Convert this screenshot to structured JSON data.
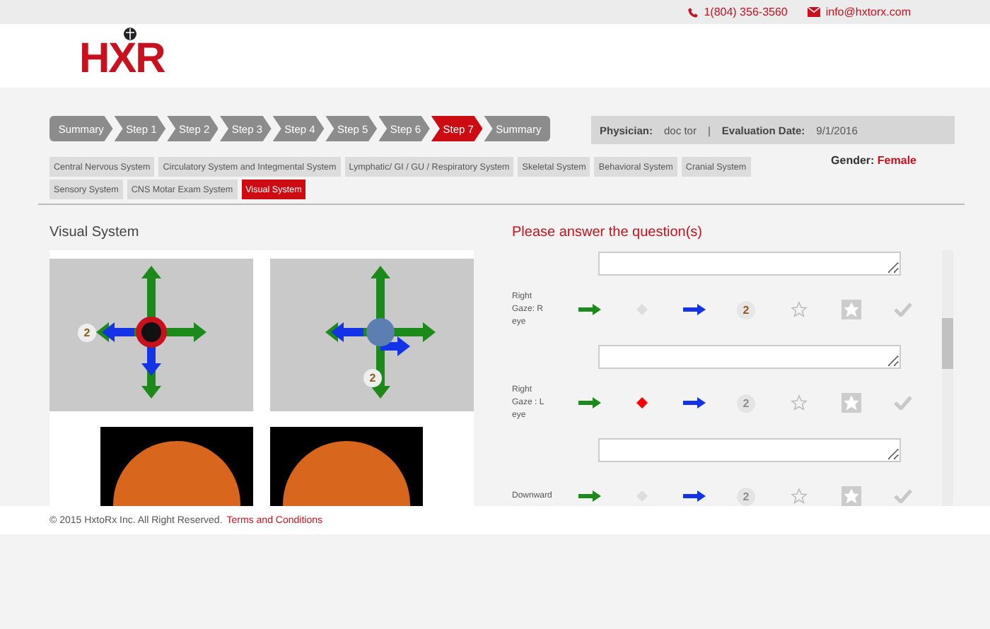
{
  "topbar": {
    "phone": "1(804) 356-3560",
    "email": "info@hxtorx.com"
  },
  "logo": {
    "text": "HXR"
  },
  "steps": [
    {
      "label": "Summary",
      "selected": false
    },
    {
      "label": "Step 1",
      "selected": false
    },
    {
      "label": "Step 2",
      "selected": false
    },
    {
      "label": "Step 3",
      "selected": false
    },
    {
      "label": "Step 4",
      "selected": false
    },
    {
      "label": "Step 5",
      "selected": false
    },
    {
      "label": "Step 6",
      "selected": false
    },
    {
      "label": "Step 7",
      "selected": true
    },
    {
      "label": "Summary",
      "selected": false
    }
  ],
  "info": {
    "physician_label": "Physician:",
    "physician": "doc tor",
    "separator": "|",
    "date_label": "Evaluation Date:",
    "date": "9/1/2016"
  },
  "gender": {
    "label": "Gender:",
    "value": "Female"
  },
  "system_tabs": [
    {
      "label": "Central Nervous System",
      "selected": false
    },
    {
      "label": "Circulatory System and Integmental System",
      "selected": false
    },
    {
      "label": "Lymphatic/ GI / GU / Respiratory System",
      "selected": false
    },
    {
      "label": "Skeletal System",
      "selected": false
    },
    {
      "label": "Behavioral System",
      "selected": false
    },
    {
      "label": "Cranial System",
      "selected": false
    },
    {
      "label": "Sensory System",
      "selected": false
    },
    {
      "label": "CNS Motar Exam System",
      "selected": false
    },
    {
      "label": "Visual System",
      "selected": true
    }
  ],
  "section_title": "Visual System",
  "eyes": [
    {
      "badge": "2"
    },
    {
      "badge": "2"
    }
  ],
  "questions_title": "Please answer the question(s)",
  "items": [
    {
      "kind": "note"
    },
    {
      "kind": "question",
      "label": "Right Gaze: R eye",
      "options": [
        {
          "kind": "arrow",
          "color": "#1b8a1b",
          "selected": true
        },
        {
          "kind": "dot",
          "selected": false
        },
        {
          "kind": "arrow",
          "color": "#1432e6",
          "selected": true
        },
        {
          "kind": "number",
          "label": "2",
          "selected": true
        },
        {
          "kind": "star",
          "selected": false
        },
        {
          "kind": "burst",
          "selected": false
        },
        {
          "kind": "check",
          "selected": false
        }
      ]
    },
    {
      "kind": "note"
    },
    {
      "kind": "question",
      "label": "Right Gaze : L eye",
      "options": [
        {
          "kind": "arrow",
          "color": "#1b8a1b",
          "selected": true
        },
        {
          "kind": "dot",
          "selected": true
        },
        {
          "kind": "arrow",
          "color": "#1432e6",
          "selected": true
        },
        {
          "kind": "number",
          "label": "2",
          "selected": false
        },
        {
          "kind": "star",
          "selected": false
        },
        {
          "kind": "burst",
          "selected": false
        },
        {
          "kind": "check",
          "selected": false
        }
      ]
    },
    {
      "kind": "note"
    },
    {
      "kind": "question",
      "label": "Downward",
      "options": [
        {
          "kind": "arrow",
          "color": "#1b8a1b",
          "selected": true
        },
        {
          "kind": "dot",
          "selected": false
        },
        {
          "kind": "arrow",
          "color": "#1432e6",
          "selected": true
        },
        {
          "kind": "number",
          "label": "2",
          "selected": false
        },
        {
          "kind": "star",
          "selected": false
        },
        {
          "kind": "burst",
          "selected": false
        },
        {
          "kind": "check",
          "selected": false
        }
      ]
    }
  ],
  "footer": {
    "text": "© 2015 HxtoRx Inc. All Right Reserved.",
    "link": "Terms and Conditions"
  }
}
